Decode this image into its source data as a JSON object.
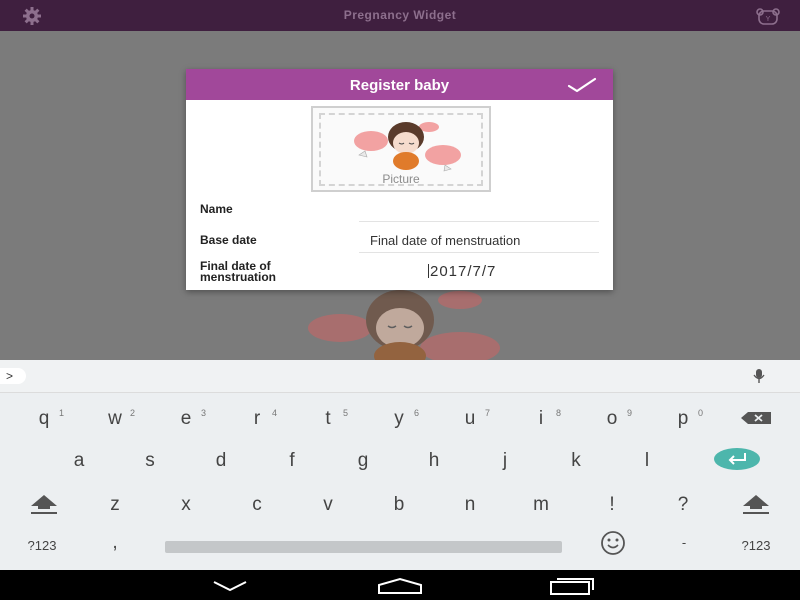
{
  "app_bar": {
    "title": "Pregnancy Widget",
    "left_icon": "gear-icon",
    "right_icon": "bear-icon"
  },
  "dialog": {
    "title": "Register baby",
    "confirm_icon": "check-icon",
    "picture_label": "Picture",
    "rows": [
      {
        "label_lines": [
          "Name"
        ],
        "value": ""
      },
      {
        "label_lines": [
          "Base date"
        ],
        "value": "Final date of menstruation"
      },
      {
        "label_lines": [
          "Final date of",
          "menstruation"
        ],
        "value": "2017/7/7"
      }
    ]
  },
  "keyboard": {
    "suggestion_arrow": ">",
    "row1": [
      {
        "k": "q",
        "n": "1"
      },
      {
        "k": "w",
        "n": "2"
      },
      {
        "k": "e",
        "n": "3"
      },
      {
        "k": "r",
        "n": "4"
      },
      {
        "k": "t",
        "n": "5"
      },
      {
        "k": "y",
        "n": "6"
      },
      {
        "k": "u",
        "n": "7"
      },
      {
        "k": "i",
        "n": "8"
      },
      {
        "k": "o",
        "n": "9"
      },
      {
        "k": "p",
        "n": "0"
      }
    ],
    "row2": [
      "a",
      "s",
      "d",
      "f",
      "g",
      "h",
      "j",
      "k",
      "l"
    ],
    "row3": [
      "z",
      "x",
      "c",
      "v",
      "b",
      "n",
      "m",
      "!",
      "?"
    ],
    "row4": {
      "left": "?123",
      "comma": ",",
      "dash": "-",
      "right": "?123"
    }
  },
  "colors": {
    "accent": "#a1489a",
    "app_bar": "#3f1f3f",
    "enter_key": "#4db6ac"
  }
}
